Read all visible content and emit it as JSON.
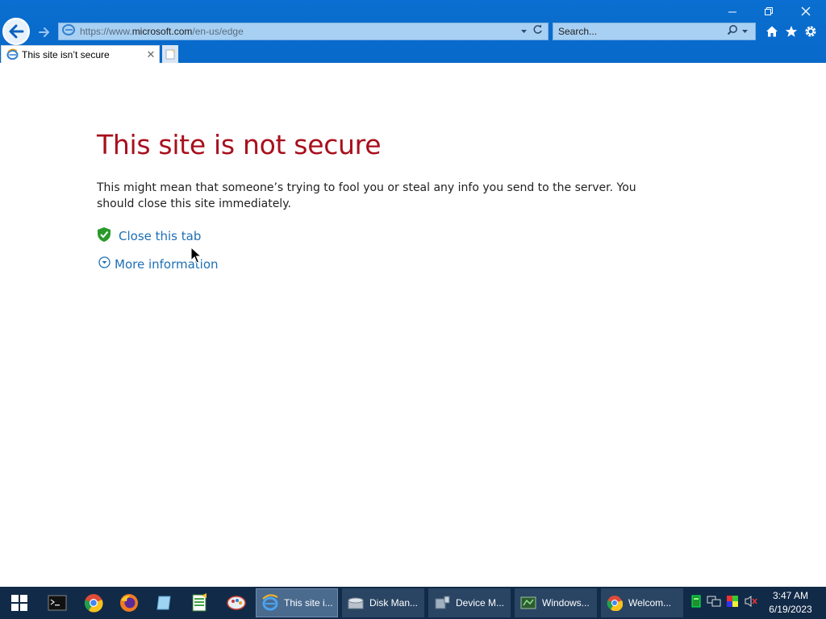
{
  "browser": {
    "address_bar": {
      "url_prefix": "https://www.",
      "url_domain": "microsoft.com",
      "url_path": "/en-us/edge"
    },
    "search": {
      "placeholder": "Search..."
    },
    "tab": {
      "title": "This site isn’t secure"
    }
  },
  "page": {
    "heading": "This site is not secure",
    "description": "This might mean that someone’s trying to fool you or steal any info you send to the server. You should close this site immediately.",
    "close_tab_link": "Close this tab",
    "more_info_link": "More information",
    "heading_color": "#a80f1d",
    "link_color": "#1d6fb5"
  },
  "taskbar": {
    "pinned": [
      "start-icon",
      "terminal-icon",
      "chrome-icon",
      "firefox-icon",
      "notepad-icon",
      "spreadsheet-icon",
      "paint-icon"
    ],
    "tasks": [
      {
        "label": "This site i...",
        "icon": "ie-icon",
        "active": true
      },
      {
        "label": "Disk Man...",
        "icon": "disk-icon",
        "active": false
      },
      {
        "label": "Device M...",
        "icon": "device-icon",
        "active": false
      },
      {
        "label": "Windows...",
        "icon": "window-icon",
        "active": false
      },
      {
        "label": "Welcom...",
        "icon": "chrome-icon",
        "active": false
      }
    ],
    "clock": {
      "time": "3:47 AM",
      "date": "6/19/2023"
    }
  }
}
